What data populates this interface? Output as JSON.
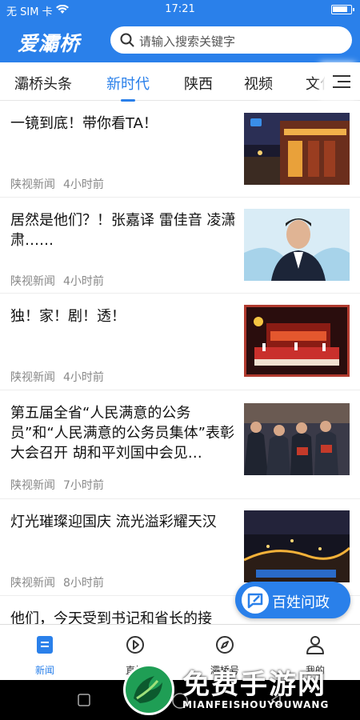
{
  "status_bar": {
    "carrier": "无 SIM 卡",
    "time": "17:21"
  },
  "app": {
    "logo": "爱灞桥",
    "search_placeholder": "请输入搜索关键字"
  },
  "tabs": [
    {
      "label": "灞桥头条",
      "active": false
    },
    {
      "label": "新时代",
      "active": true
    },
    {
      "label": "陕西",
      "active": false
    },
    {
      "label": "视频",
      "active": false
    },
    {
      "label": "文化",
      "active": false
    }
  ],
  "feed": [
    {
      "title": "一镜到底！带你看TA！",
      "source": "陕视新闻",
      "time": "4小时前",
      "image": "night-building-thumbnail"
    },
    {
      "title": "居然是他们？！张嘉译 雷佳音 凌潇肃……",
      "source": "陕视新闻",
      "time": "4小时前",
      "image": "portrait-thumbnail"
    },
    {
      "title": "独！家！剧！透！",
      "source": "陕视新闻",
      "time": "4小时前",
      "image": "stage-performance-thumbnail"
    },
    {
      "title": "第五届全省“人民满意的公务员”和“人民满意的公务员集体”表彰大会召开 胡和平刘国中会见…",
      "source": "陕视新闻",
      "time": "7小时前",
      "image": "award-ceremony-thumbnail"
    },
    {
      "title": "灯光璀璨迎国庆 流光溢彩耀天汉",
      "source": "陕视新闻",
      "time": "8小时前",
      "image": "city-lights-thumbnail"
    },
    {
      "title": "他们，今天受到书记和省长的接",
      "source": "",
      "time": "",
      "image": ""
    }
  ],
  "fab": {
    "label": "百姓问政"
  },
  "bottom_nav": [
    {
      "label": "新闻",
      "icon": "news-icon",
      "active": true
    },
    {
      "label": "直播",
      "icon": "play-icon",
      "active": false
    },
    {
      "label": "灞桥号",
      "icon": "compass-icon",
      "active": false
    },
    {
      "label": "我的",
      "icon": "user-icon",
      "active": false
    }
  ],
  "watermark": {
    "title": "免费手游网",
    "subtitle": "MIANFEISHOUYOUWANG"
  },
  "colors": {
    "accent": "#2a80ea",
    "watermark_green": "#1f9e55"
  }
}
